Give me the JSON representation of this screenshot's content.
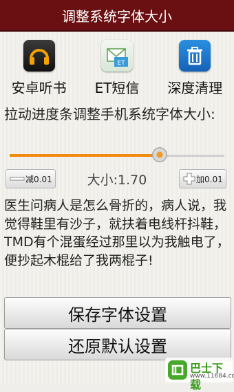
{
  "title": "调整系统字体大小",
  "apps": [
    {
      "label": "安卓听书",
      "icon": "headphones-icon"
    },
    {
      "label": "ET短信",
      "icon": "et-sms-icon"
    },
    {
      "label": "深度清理",
      "icon": "trash-icon"
    }
  ],
  "prompt": "拉动进度条调整手机系统字体大小:",
  "slider": {
    "value_fraction": 0.7
  },
  "decrease_label": "减0.01",
  "size_text": "大小:1.70",
  "increase_label": "加0.01",
  "story": "医生问病人是怎么骨折的，病人说，我觉得鞋里有沙子，就扶着电线杆抖鞋，TMD有个混蛋经过那里以为我触电了，便抄起木棍给了我两棍子!",
  "save_label": "保存字体设置",
  "restore_label": "还原默认设置",
  "watermark": {
    "brand": "巴士下载",
    "url": "www.11684.com"
  },
  "colors": {
    "titlebar": "#6a1012",
    "slider_accent": "#f08a10"
  }
}
